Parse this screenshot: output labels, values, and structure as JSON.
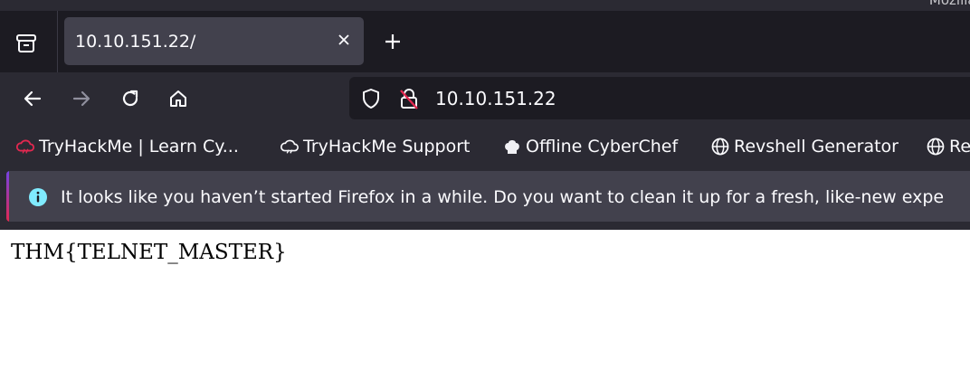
{
  "window": {
    "title": "Mozilla F"
  },
  "tabs": {
    "list_icon": "list-all-tabs-icon",
    "active": {
      "title": "10.10.151.22/",
      "close_icon": "close-icon"
    },
    "new_tab_icon": "plus-icon"
  },
  "navigation": {
    "back_icon": "arrow-left-icon",
    "forward_icon": "arrow-right-icon",
    "reload_icon": "reload-icon",
    "home_icon": "home-icon",
    "tracking_protection_icon": "shield-icon",
    "insecure_icon": "insecure-lock-icon",
    "url": "10.10.151.22"
  },
  "bookmarks": [
    {
      "label": "TryHackMe | Learn Cy...",
      "icon": "tryhackme-cloud-icon"
    },
    {
      "label": "TryHackMe Support",
      "icon": "cloud-icon"
    },
    {
      "label": "Offline CyberChef",
      "icon": "chef-hat-icon"
    },
    {
      "label": "Revshell Generator",
      "icon": "globe-icon"
    },
    {
      "label": "Re",
      "icon": "globe-icon"
    }
  ],
  "notification": {
    "icon": "info-icon",
    "message": "It looks like you haven’t started Firefox in a while. Do you want to clean it up for a fresh, like-new expe"
  },
  "page": {
    "text": "THM{TELNET_MASTER}"
  },
  "colors": {
    "toolbar": "#2b2a33",
    "tabstrip": "#1c1b22",
    "active_tab": "#42414d",
    "info_blue": "#80ebff",
    "insecure_red": "#e22850",
    "text": "#fbfbfe"
  }
}
